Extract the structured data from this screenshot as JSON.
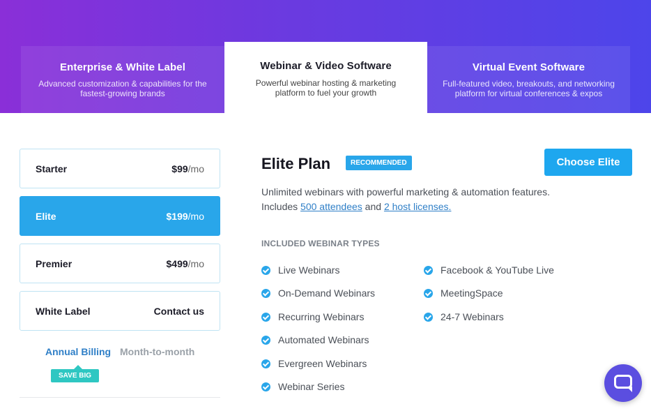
{
  "tabs": [
    {
      "title": "Enterprise & White Label",
      "desc": "Advanced customization & capabilities for the fastest-growing brands"
    },
    {
      "title": "Webinar & Video Software",
      "desc": "Powerful webinar hosting & marketing platform to fuel your growth"
    },
    {
      "title": "Virtual Event Software",
      "desc": "Full-featured video, breakouts, and networking platform for virtual conferences & expos"
    }
  ],
  "plans": [
    {
      "name": "Starter",
      "price": "$99",
      "per": "/mo"
    },
    {
      "name": "Elite",
      "price": "$199",
      "per": "/mo"
    },
    {
      "name": "Premier",
      "price": "$499",
      "per": "/mo"
    },
    {
      "name": "White Label",
      "price": "Contact us",
      "per": ""
    }
  ],
  "billing": {
    "annual": "Annual Billing",
    "monthly": "Month-to-month",
    "save_badge": "SAVE BIG"
  },
  "detail": {
    "title": "Elite Plan",
    "badge": "RECOMMENDED",
    "cta": "Choose Elite",
    "desc_line1": "Unlimited webinars with powerful marketing & automation features.",
    "desc_prefix": "Includes ",
    "attendees_link": "500 attendees",
    "desc_and": " and ",
    "hosts_link": "2 host licenses.",
    "types_heading": "INCLUDED WEBINAR TYPES",
    "types_col1": [
      "Live Webinars",
      "On-Demand Webinars",
      "Recurring Webinars",
      "Automated Webinars",
      "Evergreen Webinars",
      "Webinar Series"
    ],
    "types_col2": [
      "Facebook & YouTube Live",
      "MeetingSpace",
      "24-7 Webinars"
    ]
  },
  "colors": {
    "accent": "#29a6ea",
    "cta": "#1ea7ef",
    "badge_teal": "#2ec7c2",
    "hero_start": "#8a2fd8",
    "hero_end": "#4d45ea"
  },
  "icons": {
    "check": "check-circle-icon",
    "chat": "chat-bubble-icon"
  }
}
